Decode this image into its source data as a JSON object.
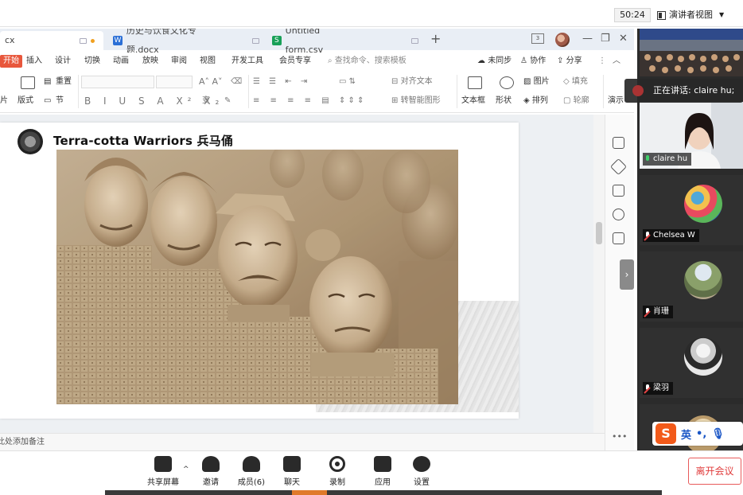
{
  "topbar": {
    "timer": "50:24",
    "presenter_view": "演讲者视图"
  },
  "wps": {
    "tabs": [
      {
        "label": "cx"
      },
      {
        "label": "历史与饮食文化专题.docx",
        "type_letter": "W"
      },
      {
        "label": "Untitled form.csv",
        "type_letter": "S"
      }
    ],
    "add_tab": "+",
    "layout_badge": "3",
    "menu": {
      "start": "开始",
      "items": [
        "插入",
        "设计",
        "切换",
        "动画",
        "放映",
        "审阅",
        "视图",
        "开发工具",
        "会员专享"
      ],
      "search": "查找命令、搜索模板",
      "sync": "未同步",
      "collab": "协作",
      "share": "分享"
    },
    "ribbon": {
      "reset": "重置",
      "layout": "版式",
      "section": "节",
      "align_text": "对齐文本",
      "smart_shape": "转智能图形",
      "textbox": "文本框",
      "shape": "形状",
      "picture": "图片",
      "arrange": "排列",
      "fill": "填充",
      "outline": "轮廓",
      "present": "演示"
    },
    "slide": {
      "title": "Terra-cotta Warriors 兵马俑"
    },
    "notes": "单击此处添加备注"
  },
  "meeting": {
    "speaking": "正在讲话: claire hu;",
    "participants": [
      {
        "name": "claire hu",
        "mic": "on"
      },
      {
        "name": "Chelsea W",
        "mic": "muted"
      },
      {
        "name": "肖珊",
        "mic": "muted"
      },
      {
        "name": "梁羽",
        "mic": "muted"
      }
    ],
    "ime": {
      "lang": "英"
    },
    "toolbar": {
      "share": "共享屏幕",
      "invite": "邀请",
      "members": "成员(6)",
      "chat": "聊天",
      "record": "录制",
      "apps": "应用",
      "settings": "设置",
      "leave": "离开会议"
    }
  },
  "colors": {
    "accent_red": "#e8573c",
    "leave_red": "#e03c3c",
    "panel_dark": "#2b2b2b"
  }
}
